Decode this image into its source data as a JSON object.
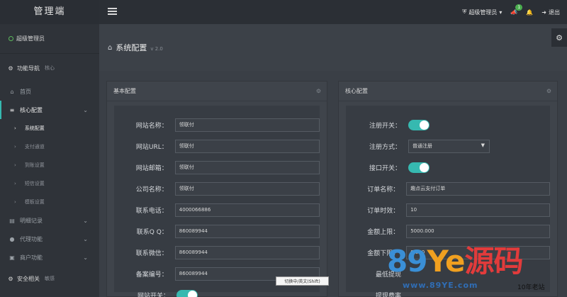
{
  "brand": {
    "title": "管理端"
  },
  "topbar": {
    "admin_label": "超级管理员",
    "notify_count": "1",
    "logout_label": "退出"
  },
  "sidebar": {
    "user_label": "超级管理员",
    "section_title": "功能导航",
    "section_sub": "核心",
    "items": [
      {
        "label": "首页"
      },
      {
        "label": "核心配置"
      },
      {
        "label": "明细记录"
      },
      {
        "label": "代理功能"
      },
      {
        "label": "商户功能"
      }
    ],
    "children": [
      {
        "label": "系统配置"
      },
      {
        "label": "支付通道"
      },
      {
        "label": "到账设置"
      },
      {
        "label": "短信设置"
      },
      {
        "label": "模板设置"
      }
    ],
    "footer_section_title": "安全相关",
    "footer_section_sub": "敏感"
  },
  "page": {
    "title": "系统配置",
    "version": "v 2.0"
  },
  "left_panel": {
    "title": "基本配置",
    "fields": [
      {
        "label": "网站名称：",
        "value": "领联付"
      },
      {
        "label": "网站URL：",
        "value": "领联付"
      },
      {
        "label": "网站邮箱：",
        "value": "领联付"
      },
      {
        "label": "公司名称：",
        "value": "领联付"
      },
      {
        "label": "联系电话：",
        "value": "4000066886"
      },
      {
        "label": "联系Q Q：",
        "value": "860089944"
      },
      {
        "label": "联系微信：",
        "value": "860089944"
      },
      {
        "label": "备案编号：",
        "value": "860089944"
      }
    ],
    "switch_label": "网站开关："
  },
  "right_panel": {
    "title": "核心配置",
    "register_switch_label": "注册开关：",
    "register_mode_label": "注册方式：",
    "register_mode_value": "普通注册",
    "port_switch_label": "接口开关：",
    "fields": [
      {
        "label": "订单名称：",
        "value": "趣点云支付订单"
      },
      {
        "label": "订单时效：",
        "value": "10"
      },
      {
        "label": "金额上限：",
        "value": "5000.000"
      },
      {
        "label": "金额下限：",
        "value": "0.010"
      }
    ],
    "min_label": "最低提现",
    "rate_label": "提现费率"
  },
  "tooltip": "切换中/英文(Shift)",
  "watermark": {
    "a": "89",
    "b": "Ye",
    "c": "源码",
    "url": "www.89YE.com",
    "tag": "10年老站"
  },
  "colors": {
    "accent": "#36b9b0",
    "topbar": "#2b2f35",
    "sidebar": "#2f3339"
  }
}
